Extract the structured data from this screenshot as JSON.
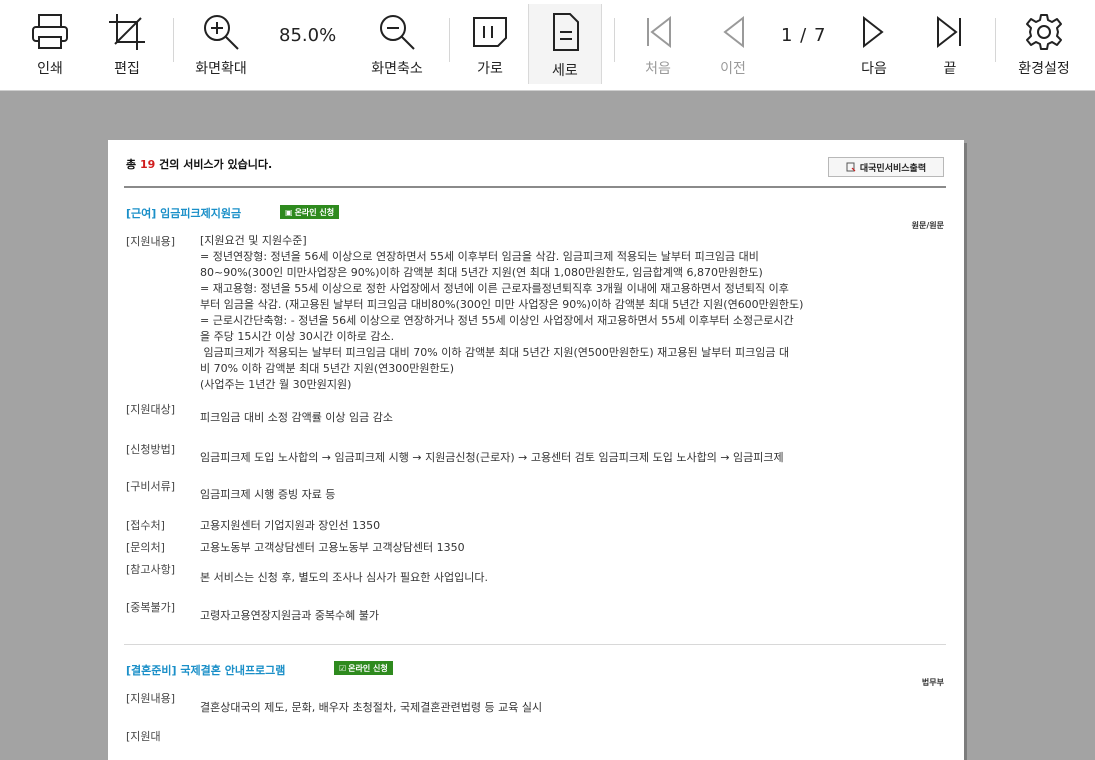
{
  "toolbar": {
    "print": "인쇄",
    "edit": "편집",
    "zoom_in": "화면확대",
    "zoom_value": "85.0%",
    "zoom_out": "화면축소",
    "landscape": "가로",
    "portrait": "세로",
    "first": "처음",
    "prev": "이전",
    "page_indicator": "1 / 7",
    "next": "다음",
    "last": "끝",
    "settings": "환경설정"
  },
  "document": {
    "header_prefix": "총",
    "header_count": "19",
    "header_suffix": "건의 서비스가 있습니다.",
    "print_button": "대국민서비스출력",
    "services": [
      {
        "category": "[근여]",
        "name": "임금피크제지원금",
        "online": "온라인 신청",
        "dept": "원문/원문",
        "rows": [
          {
            "label": "[지원내용]",
            "value": "[지원요건 및 지원수준]\n= 정년연장형: 정년을 56세 이상으로 연장하면서 55세 이후부터 임금을 삭감. 임금피크제 적용되는 날부터 피크임금 대비\n80~90%(300인 미만사업장은 90%)이하 감액분 최대 5년간 지원(연 최대 1,080만원한도, 임금합계액 6,870만원한도)\n= 재고용형: 정년을 55세 이상으로 정한 사업장에서 정년에 이른 근로자를정년퇴직후 3개월 이내에 재고용하면서 정년퇴직 이후\n부터 임금을 삭감. (재고용된 날부터 피크임금 대비80%(300인 미만 사업장은 90%)이하 감액분 최대 5년간 지원(연600만원한도)\n= 근로시간단축형: - 정년을 56세 이상으로 연장하거나 정년 55세 이상인 사업장에서 재고용하면서 55세 이후부터 소정근로시간\n을 주당 15시간 이상 30시간 이하로 감소.\n 임금피크제가 적용되는 날부터 피크임금 대비 70% 이하 감액분 최대 5년간 지원(연500만원한도) 재고용된 날부터 피크임금 대\n비 70% 이하 감액분 최대 5년간 지원(연300만원한도)\n(사업주는 1년간 월 30만원지원)"
          },
          {
            "label": "[지원대상]",
            "value": "피크임금 대비 소정 감액률 이상 임금 감소"
          },
          {
            "label": "[신청방법]",
            "value": "임금피크제 도입 노사합의 → 임금피크제 시행 → 지원금신청(근로자) → 고용센터 검토 임금피크제 도입 노사합의 → 임금피크제"
          },
          {
            "label": "[구비서류]",
            "value": "임금피크제 시행 증빙 자료 등"
          },
          {
            "label": "[접수처]",
            "value": "고용지원센터 기업지원과 장인선 1350"
          },
          {
            "label": "[문의처]",
            "value": "고용노동부 고객상담센터 고용노동부 고객상담센터 1350"
          },
          {
            "label": "[참고사항]",
            "value": "본 서비스는 신청 후, 별도의 조사나 심사가 필요한 사업입니다."
          },
          {
            "label": "[중복불가]",
            "value": "고령자고용연장지원금과 중복수혜 불가"
          }
        ]
      },
      {
        "category": "[결혼준비]",
        "name": "국제결혼 안내프로그램",
        "online": "온라인 신청",
        "dept": "법무부",
        "rows": [
          {
            "label": "[지원내용]",
            "value": "결혼상대국의 제도, 문화, 배우자 초청절차, 국제결혼관련법령 등 교육 실시"
          },
          {
            "label": "[지원대",
            "value": ""
          }
        ]
      }
    ]
  }
}
